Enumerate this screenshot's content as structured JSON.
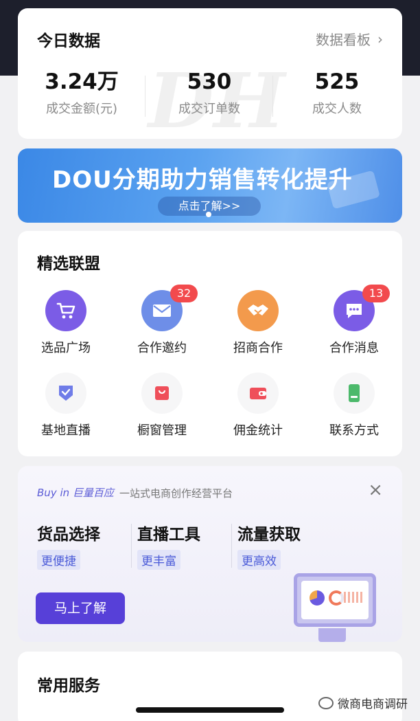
{
  "today": {
    "title": "今日数据",
    "dashboard_link": "数据看板",
    "stats": [
      {
        "value": "3.24万",
        "label": "成交金额(元)"
      },
      {
        "value": "530",
        "label": "成交订单数"
      },
      {
        "value": "525",
        "label": "成交人数"
      }
    ]
  },
  "banner": {
    "title": "DOU分期助力销售转化提升",
    "cta": "点击了解>>"
  },
  "alliance": {
    "title": "精选联盟",
    "items": [
      {
        "label": "选品广场",
        "icon": "cart-icon",
        "badge": ""
      },
      {
        "label": "合作邀约",
        "icon": "mail-icon",
        "badge": "32"
      },
      {
        "label": "招商合作",
        "icon": "handshake-icon",
        "badge": ""
      },
      {
        "label": "合作消息",
        "icon": "chat-icon",
        "badge": "13"
      },
      {
        "label": "基地直播",
        "icon": "shield-icon",
        "badge": ""
      },
      {
        "label": "橱窗管理",
        "icon": "bag-icon",
        "badge": ""
      },
      {
        "label": "佣金统计",
        "icon": "wallet-icon",
        "badge": ""
      },
      {
        "label": "联系方式",
        "icon": "phone-icon",
        "badge": ""
      }
    ]
  },
  "promo": {
    "brand": "Buy in 巨量百应",
    "subtitle": "一站式电商创作经营平台",
    "columns": [
      {
        "heading": "货品选择",
        "tag": "更便捷"
      },
      {
        "heading": "直播工具",
        "tag": "更丰富"
      },
      {
        "heading": "流量获取",
        "tag": "更高效"
      }
    ],
    "cta": "马上了解"
  },
  "services": {
    "title": "常用服务"
  },
  "watermark": "微商电商调研",
  "colors": {
    "badge": "#f24a4d",
    "accent": "#5740d8",
    "purple_icon": "#7b5ce6",
    "orange_icon": "#f39a4c",
    "red_icon": "#ef4f5a",
    "green_icon": "#4cb96b"
  }
}
